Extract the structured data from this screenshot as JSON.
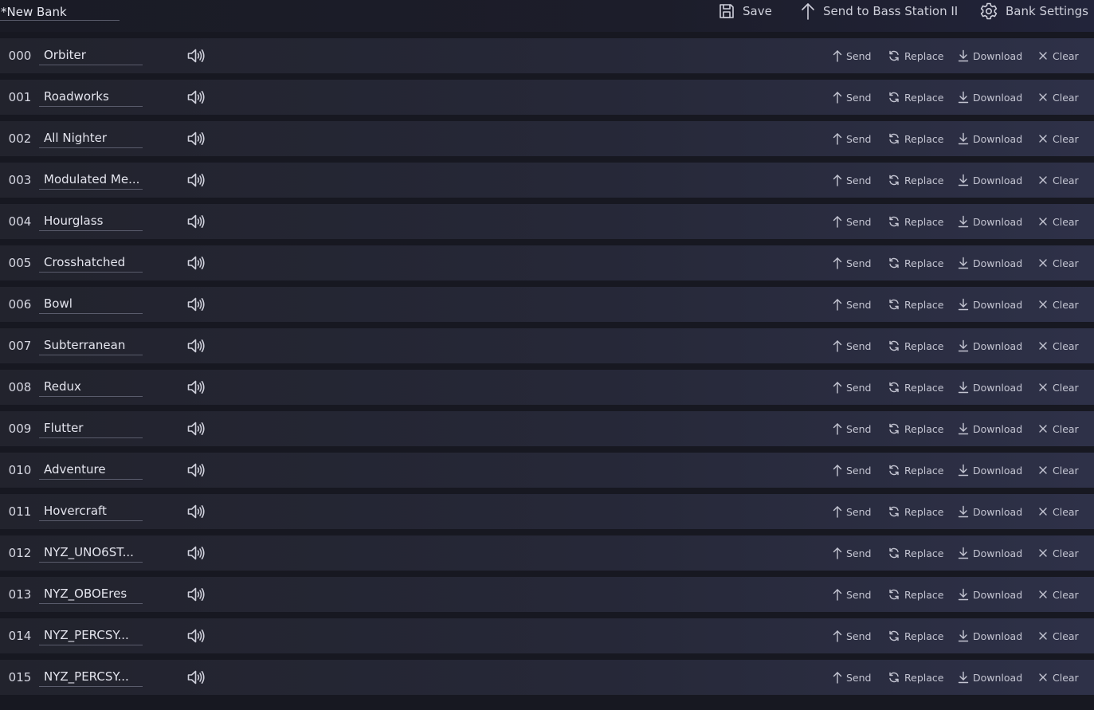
{
  "bank": {
    "name": "*New Bank"
  },
  "toolbar": {
    "save_label": "Save",
    "send_label": "Send to Bass Station II",
    "settings_label": "Bank Settings"
  },
  "actions": {
    "send": "Send",
    "replace": "Replace",
    "download": "Download",
    "clear": "Clear"
  },
  "icons": {
    "save": "save-icon",
    "send_arrow": "arrow-up-icon",
    "settings": "gear-icon",
    "speaker": "speaker-icon",
    "replace": "replace-icon",
    "download": "download-icon",
    "clear": "close-icon"
  },
  "patches": [
    {
      "number": "000",
      "name": "Orbiter"
    },
    {
      "number": "001",
      "name": "Roadworks"
    },
    {
      "number": "002",
      "name": "All Nighter"
    },
    {
      "number": "003",
      "name": "Modulated Me..."
    },
    {
      "number": "004",
      "name": "Hourglass"
    },
    {
      "number": "005",
      "name": "Crosshatched"
    },
    {
      "number": "006",
      "name": "Bowl"
    },
    {
      "number": "007",
      "name": "Subterranean"
    },
    {
      "number": "008",
      "name": "Redux"
    },
    {
      "number": "009",
      "name": "Flutter"
    },
    {
      "number": "010",
      "name": "Adventure"
    },
    {
      "number": "011",
      "name": "Hovercraft"
    },
    {
      "number": "012",
      "name": "NYZ_UNO6ST..."
    },
    {
      "number": "013",
      "name": "NYZ_OBOEres"
    },
    {
      "number": "014",
      "name": "NYZ_PERCSY..."
    },
    {
      "number": "015",
      "name": "NYZ_PERCSY..."
    }
  ]
}
